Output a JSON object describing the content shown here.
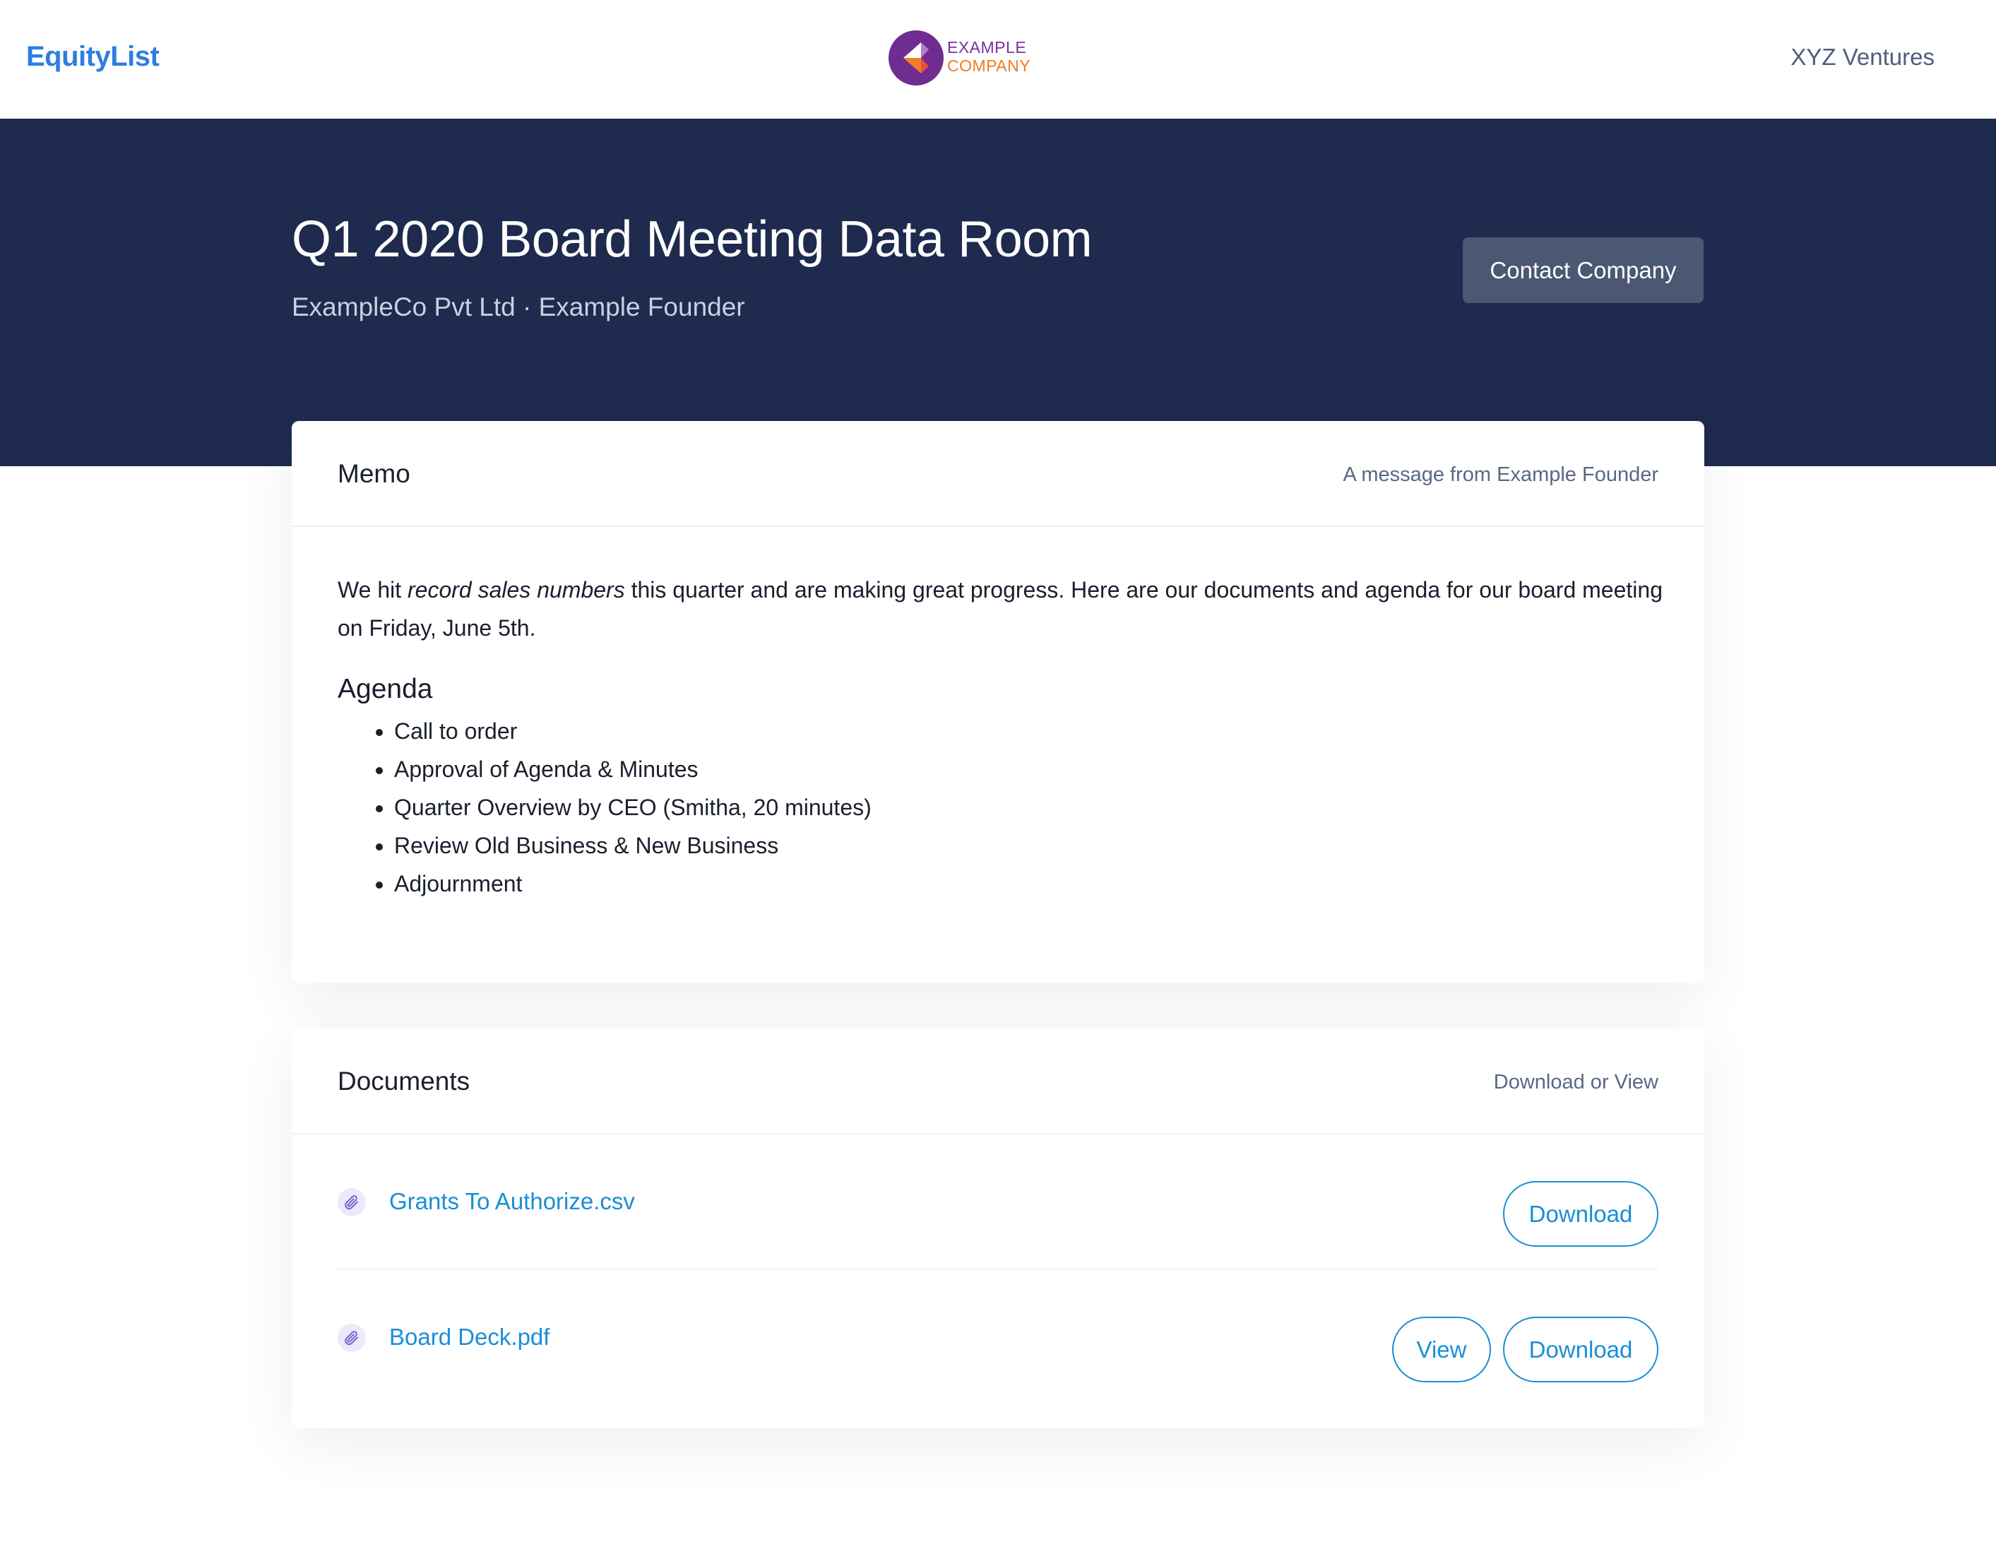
{
  "nav": {
    "brand": "EquityList",
    "company_logo_line1": "EXAMPLE",
    "company_logo_line2": "COMPANY",
    "investor": "XYZ Ventures"
  },
  "hero": {
    "title": "Q1 2020 Board Meeting Data Room",
    "subtitle": "ExampleCo Pvt Ltd · Example Founder",
    "contact_button": "Contact Company"
  },
  "memo": {
    "title": "Memo",
    "note": "A message from Example Founder",
    "text_before": "We hit ",
    "text_emphasis": "record sales numbers",
    "text_after": " this quarter and are making great progress. Here are our documents and agenda for our board meeting on Friday, June 5th.",
    "agenda_heading": "Agenda",
    "agenda_items": [
      "Call to order",
      "Approval of Agenda & Minutes",
      "Quarter Overview by CEO (Smitha, 20 minutes)",
      "Review Old Business & New Business",
      "Adjournment"
    ]
  },
  "documents": {
    "title": "Documents",
    "note": "Download or View",
    "items": [
      {
        "name": "Grants To Authorize.csv",
        "download_label": "Download"
      },
      {
        "name": "Board Deck.pdf",
        "view_label": "View",
        "download_label": "Download"
      }
    ]
  },
  "colors": {
    "brand": "#2d7ee0",
    "hero_bg": "#1e2a4e",
    "link": "#1a8ed6",
    "contact_button_bg": "#4c5774",
    "logo_purple": "#7b2f9e",
    "logo_orange": "#f07a1f"
  },
  "icons": {
    "company_logo": "example-company-logo",
    "document": "paperclip-icon"
  }
}
